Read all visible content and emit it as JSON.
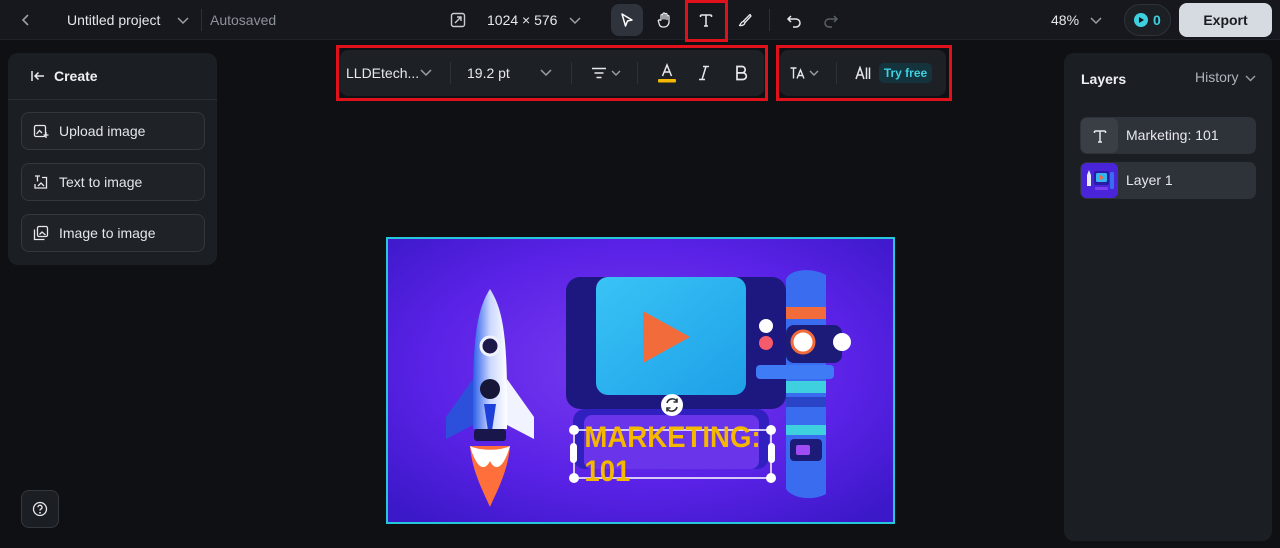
{
  "topbar": {
    "project_title": "Untitled project",
    "autosave_status": "Autosaved",
    "canvas_size": "1024 × 576",
    "zoom": "48%",
    "credits": "0",
    "export_label": "Export"
  },
  "text_toolbar": {
    "font_family": "LLDEtech...",
    "font_size": "19.2 pt",
    "try_free_label": "Try free",
    "text_color": "#f5b800"
  },
  "create_panel": {
    "title": "Create",
    "items": [
      {
        "label": "Upload image",
        "icon": "upload-image-icon"
      },
      {
        "label": "Text to image",
        "icon": "text-to-image-icon"
      },
      {
        "label": "Image to image",
        "icon": "image-to-image-icon"
      }
    ]
  },
  "layers_panel": {
    "title": "Layers",
    "history_label": "History",
    "layers": [
      {
        "label": "Marketing: 101",
        "icon": "text-layer-icon"
      },
      {
        "label": "Layer 1",
        "icon": "image-layer-thumbnail"
      }
    ]
  },
  "canvas": {
    "headline": "MARKETING: 101",
    "background_color": "#5a22e6",
    "accent_color": "#25c7d8"
  },
  "colors": {
    "annotation_red": "#e0111b",
    "export_bg": "#d6dbe2"
  }
}
